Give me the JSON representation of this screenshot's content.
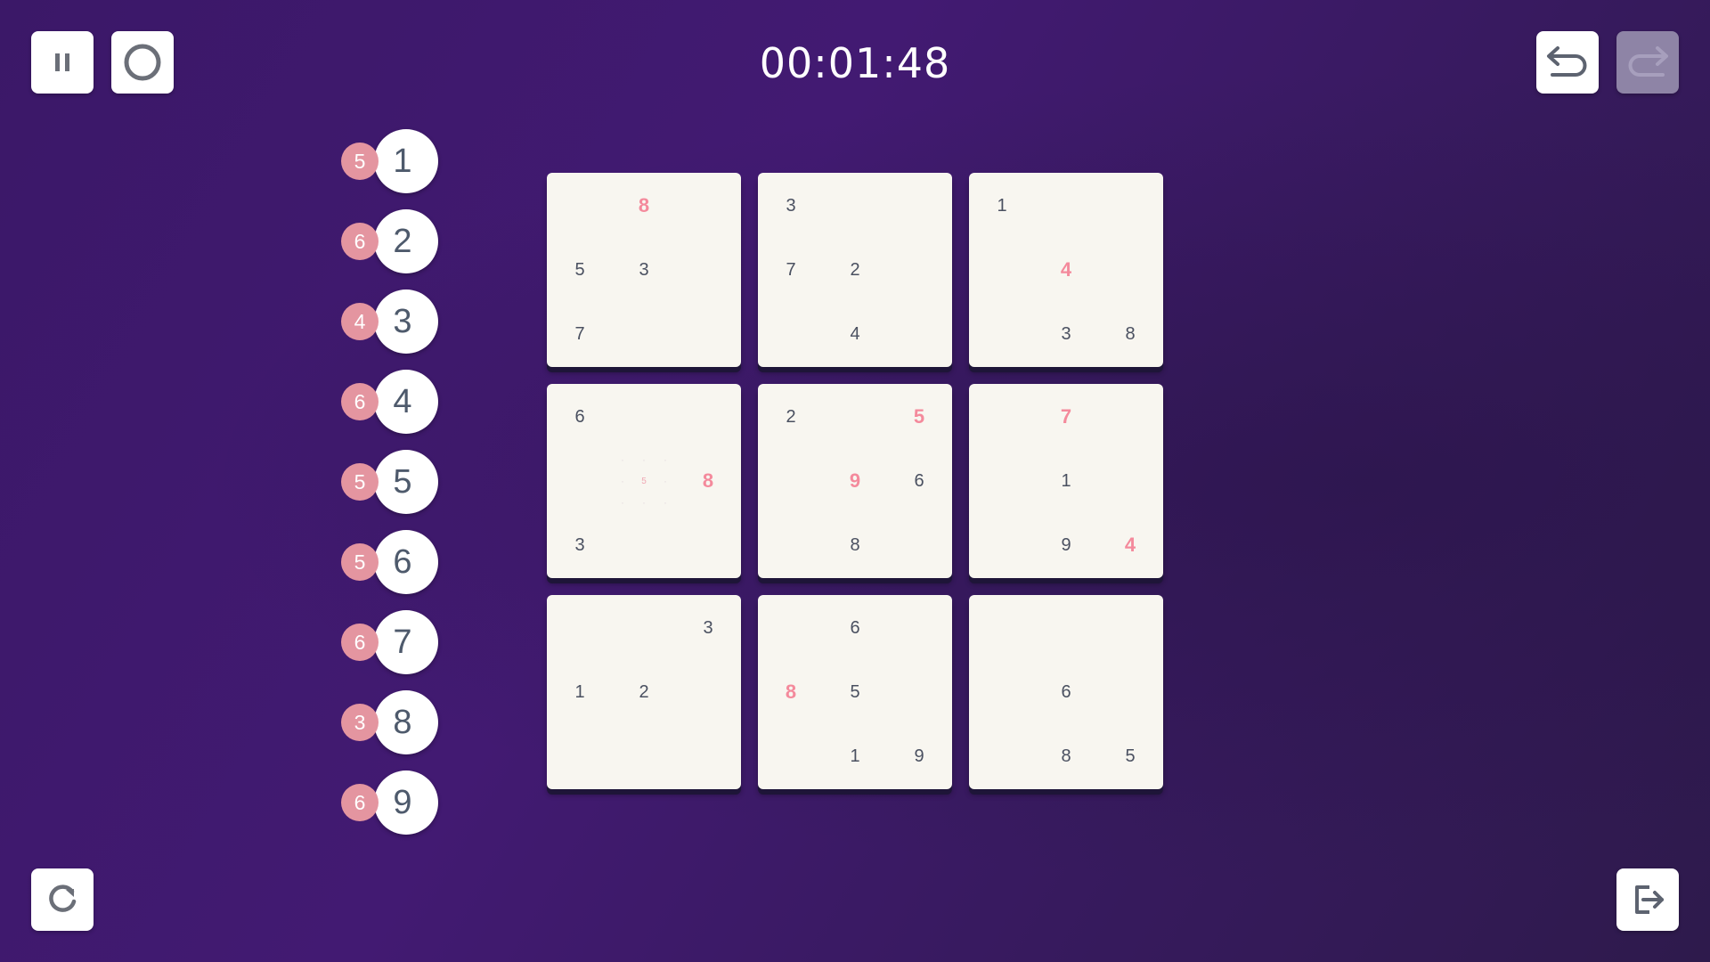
{
  "header": {
    "timer": "00:01:48",
    "pause_icon": "pause-icon",
    "hint_icon": "circle-icon",
    "undo_icon": "undo-icon",
    "redo_icon": "redo-icon"
  },
  "footer": {
    "restart_icon": "restart-icon",
    "exit_icon": "exit-icon"
  },
  "number_pad": [
    {
      "digit": "1",
      "count": "5"
    },
    {
      "digit": "2",
      "count": "6"
    },
    {
      "digit": "3",
      "count": "4"
    },
    {
      "digit": "4",
      "count": "6"
    },
    {
      "digit": "5",
      "count": "5"
    },
    {
      "digit": "6",
      "count": "5"
    },
    {
      "digit": "7",
      "count": "6"
    },
    {
      "digit": "8",
      "count": "3"
    },
    {
      "digit": "9",
      "count": "6"
    }
  ],
  "grid": [
    [
      "",
      "8",
      "",
      "3",
      "",
      "",
      "1",
      "",
      ""
    ],
    [
      "5",
      "3",
      "",
      "7",
      "2",
      "",
      "",
      "4",
      ""
    ],
    [
      "7",
      "",
      "",
      "",
      "4",
      "",
      "",
      "3",
      "8"
    ],
    [
      "6",
      "",
      "",
      "2",
      "",
      "5",
      "",
      "7",
      ""
    ],
    [
      "",
      "",
      "8",
      "",
      "9",
      "6",
      "",
      "1",
      ""
    ],
    [
      "3",
      "",
      "",
      "",
      "8",
      "",
      "",
      "9",
      "4"
    ],
    [
      "",
      "",
      "3",
      "",
      "6",
      "",
      "",
      "",
      ""
    ],
    [
      "1",
      "2",
      "",
      "8",
      "5",
      "",
      "",
      "6",
      ""
    ],
    [
      "",
      "",
      "",
      "",
      "1",
      "9",
      "",
      "8",
      "5"
    ]
  ],
  "error_cells": [
    [
      0,
      1
    ],
    [
      1,
      7
    ],
    [
      3,
      5
    ],
    [
      3,
      7
    ],
    [
      4,
      2
    ],
    [
      4,
      4
    ],
    [
      5,
      8
    ],
    [
      7,
      3
    ]
  ],
  "notes": {
    "row": 4,
    "col": 1,
    "value": "5"
  },
  "colors": {
    "error": "#f48a9c",
    "badge": "#e495a0",
    "digit": "#4a5060",
    "board_bg": "#f8f6f0"
  }
}
